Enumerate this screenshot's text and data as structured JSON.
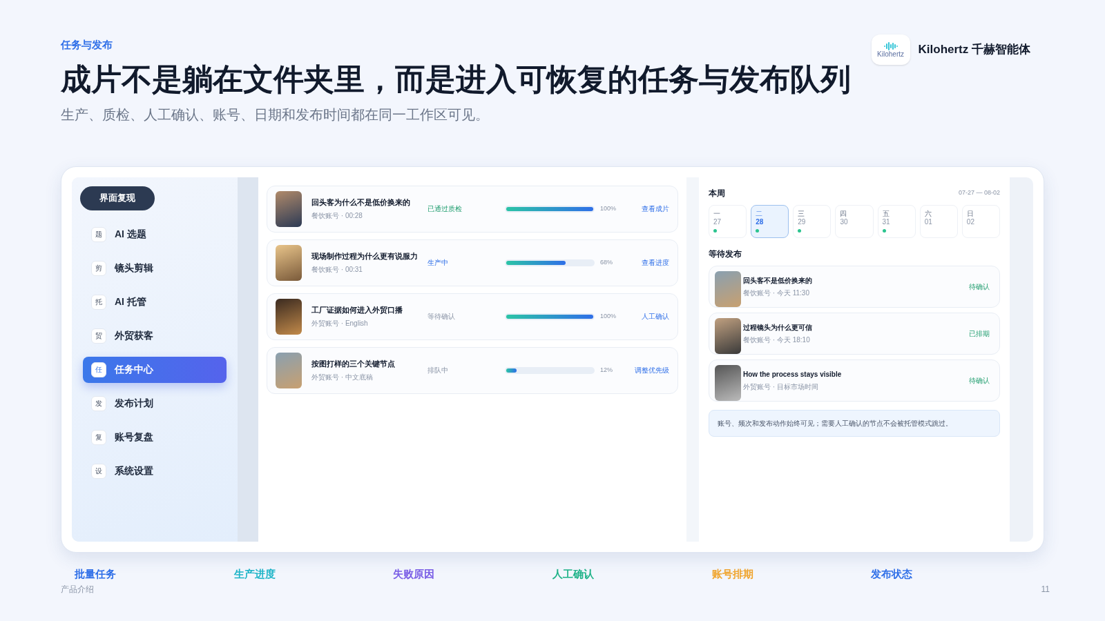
{
  "header": {
    "eyebrow": "任务与发布",
    "title": "成片不是躺在文件夹里，而是进入可恢复的任务与发布队列",
    "subtitle": "生产、质检、人工确认、账号、日期和发布时间都在同一工作区可见。",
    "brand": {
      "logo_text": "Kilohertz",
      "name": "Kilohertz 千赫智能体"
    }
  },
  "overlay_badge": "界面复现",
  "sidebar": {
    "items": [
      {
        "icon": "题",
        "label": "AI 选题",
        "selected": false
      },
      {
        "icon": "剪",
        "label": "镜头剪辑",
        "selected": false
      },
      {
        "icon": "托",
        "label": "AI 托管",
        "selected": false
      },
      {
        "icon": "贸",
        "label": "外贸获客",
        "selected": false
      },
      {
        "icon": "任",
        "label": "任务中心",
        "selected": true
      },
      {
        "icon": "发",
        "label": "发布计划",
        "selected": false
      },
      {
        "icon": "复",
        "label": "账号复盘",
        "selected": false
      },
      {
        "icon": "设",
        "label": "系统设置",
        "selected": false
      }
    ]
  },
  "tasks": [
    {
      "title": "回头客为什么不是低价换来的",
      "meta": "餐饮账号 · 00:28",
      "status": "已通过质检",
      "kind": "done",
      "level": 1,
      "percent": "100%",
      "action": "查看成片"
    },
    {
      "title": "现场制作过程为什么更有说服力",
      "meta": "餐饮账号 · 00:31",
      "status": "生产中",
      "kind": "active",
      "level": 0.68,
      "percent": "68%",
      "action": "查看进度"
    },
    {
      "title": "工厂证据如何进入外贸口播",
      "meta": "外贸账号 · English",
      "status": "等待确认",
      "kind": "waiting",
      "level": 1,
      "percent": "100%",
      "action": "人工确认"
    },
    {
      "title": "按图打样的三个关键节点",
      "meta": "外贸账号 · 中文底稿",
      "status": "排队中",
      "kind": "queued",
      "level": 0.12,
      "percent": "12%",
      "action": "调整优先级"
    }
  ],
  "week": {
    "title": "本周",
    "range": "07-27 — 08-02",
    "days": [
      {
        "weekday": "一",
        "date": "27",
        "selected": false,
        "scheduled": true
      },
      {
        "weekday": "二",
        "date": "28",
        "selected": true,
        "scheduled": true
      },
      {
        "weekday": "三",
        "date": "29",
        "selected": false,
        "scheduled": true
      },
      {
        "weekday": "四",
        "date": "30",
        "selected": false,
        "scheduled": false
      },
      {
        "weekday": "五",
        "date": "31",
        "selected": false,
        "scheduled": true
      },
      {
        "weekday": "六",
        "date": "01",
        "selected": false,
        "scheduled": false
      },
      {
        "weekday": "日",
        "date": "02",
        "selected": false,
        "scheduled": false
      }
    ]
  },
  "queue": {
    "title": "等待发布",
    "items": [
      {
        "title": "回头客不是低价换来的",
        "meta": "餐饮账号 · 今天 11:30",
        "status": "待确认"
      },
      {
        "title": "过程镜头为什么更可信",
        "meta": "餐饮账号 · 今天 18:10",
        "status": "已排期"
      },
      {
        "title": "How the process stays visible",
        "meta": "外贸账号 · 目标市场时间",
        "status": "待确认"
      }
    ],
    "note": "账号、频次和发布动作始终可见；需要人工确认的节点不会被托管模式跳过。"
  },
  "features": [
    {
      "label": "批量任务",
      "color": "#2f6fe8"
    },
    {
      "label": "生产进度",
      "color": "#1fb5c8"
    },
    {
      "label": "失败原因",
      "color": "#7a5ee6"
    },
    {
      "label": "人工确认",
      "color": "#20b389"
    },
    {
      "label": "账号排期",
      "color": "#f0a42c"
    },
    {
      "label": "发布状态",
      "color": "#2f6fe8"
    }
  ],
  "footer": {
    "left": "产品介绍",
    "page": "11"
  }
}
